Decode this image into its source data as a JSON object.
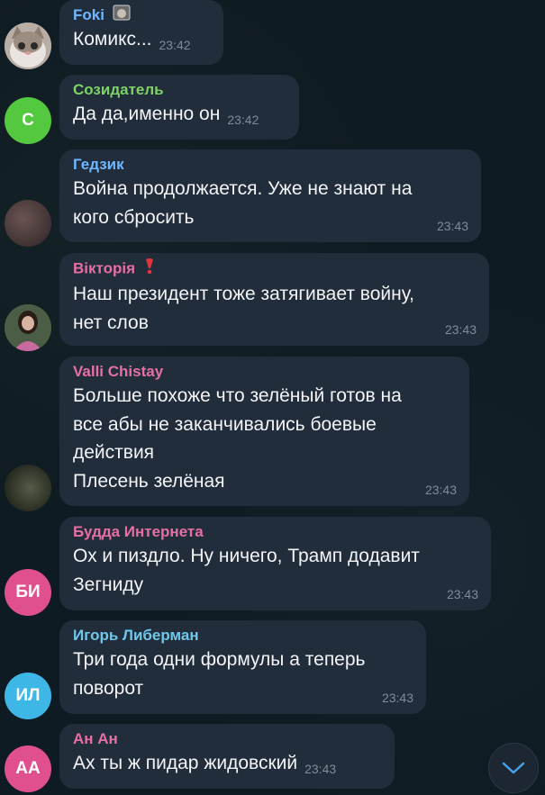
{
  "messages": [
    {
      "sender": "Foki",
      "sender_color": "#6fb8ff",
      "text": "Комикс...",
      "time": "23:42",
      "avatar": {
        "type": "photo",
        "name": "cat-avatar"
      }
    },
    {
      "sender": "Созидатель",
      "sender_color": "#7ed364",
      "text": "Да да,именно он",
      "time": "23:42",
      "avatar": {
        "type": "initials",
        "initials": "С",
        "color": "#54c83f"
      }
    },
    {
      "sender": "Гедзик",
      "sender_color": "#6fb8ff",
      "lines": [
        "Война продолжается. Уже не знают на",
        "кого сбросить"
      ],
      "time": "23:43",
      "avatar": {
        "type": "photo",
        "name": "blurred-avatar"
      }
    },
    {
      "sender": "Вікторія",
      "sender_color": "#e86fa6",
      "lines": [
        "Наш президент тоже затягивает войну,",
        "нет слов"
      ],
      "time": "23:43",
      "avatar": {
        "type": "photo",
        "name": "woman-avatar"
      }
    },
    {
      "sender": "Valli Chistay",
      "sender_color": "#e86fa6",
      "lines": [
        "Больше похоже что зелёный готов на",
        "все абы не заканчивались боевые",
        "действия",
        "Плесень зелёная"
      ],
      "time": "23:43",
      "avatar": {
        "type": "photo",
        "name": "dark-avatar"
      }
    },
    {
      "sender": "Будда Интернета",
      "sender_color": "#e86fa6",
      "lines": [
        "Ох и пиздло. Ну ничего, Трамп додавит",
        "Зегниду"
      ],
      "time": "23:43",
      "avatar": {
        "type": "initials",
        "initials": "БИ",
        "color": "#e0508f"
      }
    },
    {
      "sender": "Игорь Либерман",
      "sender_color": "#6fc8ea",
      "lines": [
        "Три года одни формулы а теперь",
        "поворот"
      ],
      "time": "23:43",
      "avatar": {
        "type": "initials",
        "initials": "ИЛ",
        "color": "#3fb7e6"
      }
    },
    {
      "sender": "Ан Ан",
      "sender_color": "#e86fa6",
      "text": "Ах ты ж пидар жидовский",
      "time": "23:43",
      "avatar": {
        "type": "initials",
        "initials": "АА",
        "color": "#e0508f"
      }
    }
  ],
  "scroll_button": {
    "icon": "chevron-down-icon"
  }
}
